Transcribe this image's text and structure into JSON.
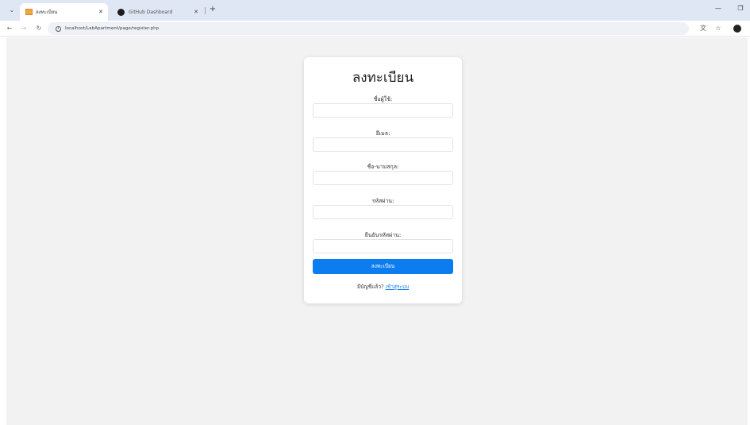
{
  "browser": {
    "tabs": [
      {
        "title": "ลงทะเบียน",
        "active": true,
        "favicon": "apartment-favicon"
      },
      {
        "title": "GitHub Dashboard",
        "active": false,
        "favicon": "github-icon"
      }
    ],
    "url": "localhost/LabApartment/page/register.php",
    "icons": {
      "tab_search": "chevron-down-icon",
      "back": "back-arrow-icon",
      "forward": "forward-arrow-icon",
      "reload": "reload-icon",
      "site_info": "info-icon",
      "translate": "translate-icon",
      "bookmark": "star-icon",
      "profile": "profile-icon"
    }
  },
  "form": {
    "title": "ลงทะเบียน",
    "fields": [
      {
        "label": "ชื่อผู้ใช้:",
        "value": "",
        "placeholder": ""
      },
      {
        "label": "อีเมล:",
        "value": "",
        "placeholder": ""
      },
      {
        "label": "ชื่อ-นามสกุล:",
        "value": "",
        "placeholder": ""
      },
      {
        "label": "รหัสผ่าน:",
        "value": "",
        "placeholder": ""
      },
      {
        "label": "ยืนยันรหัสผ่าน:",
        "value": "",
        "placeholder": ""
      }
    ],
    "submit_label": "ลงทะเบียน",
    "login_prompt": "มีบัญชีแล้ว?",
    "login_link": "เข้าสู่ระบบ"
  },
  "colors": {
    "primary": "#0b7df0",
    "page_background": "#f2f2f2",
    "card_background": "#ffffff",
    "tabstrip": "#dfe6f4"
  }
}
